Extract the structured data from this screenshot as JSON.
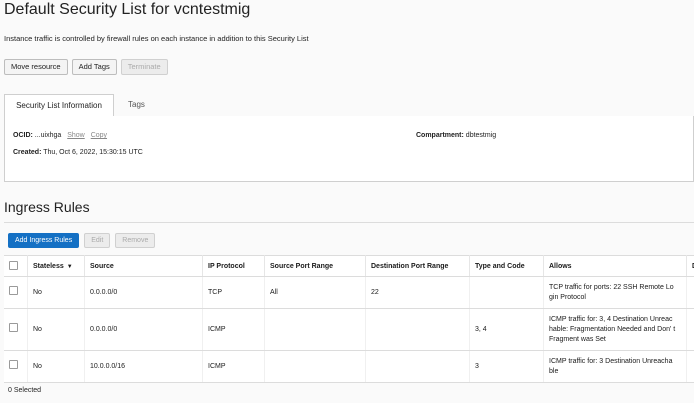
{
  "header": {
    "title": "Default Security List for vcntestmig",
    "description": "Instance traffic is controlled by firewall rules on each instance in addition to this Security List"
  },
  "actions": {
    "move": "Move resource",
    "tags": "Add Tags",
    "terminate": "Terminate"
  },
  "tabs": [
    {
      "label": "Security List Information"
    },
    {
      "label": "Tags"
    }
  ],
  "info": {
    "ocid_label": "OCID:",
    "ocid_value": "...uixhga",
    "show": "Show",
    "copy": "Copy",
    "created_label": "Created:",
    "created_value": "Thu, Oct 6, 2022, 15:30:15 UTC",
    "compartment_label": "Compartment:",
    "compartment_value": "dbtestmig"
  },
  "ingress": {
    "title": "Ingress Rules",
    "add": "Add Ingress Rules",
    "edit": "Edit",
    "remove": "Remove",
    "columns": [
      "Stateless",
      "Source",
      "IP Protocol",
      "Source Port Range",
      "Destination Port Range",
      "Type and Code",
      "Allows",
      "D"
    ],
    "rows": [
      {
        "stateless": "No",
        "source": "0.0.0.0/0",
        "protocol": "TCP",
        "src_port": "All",
        "dst_port": "22",
        "type_code": "",
        "allows": "TCP traffic for ports: 22 SSH Remote Lo gin Protocol"
      },
      {
        "stateless": "No",
        "source": "0.0.0.0/0",
        "protocol": "ICMP",
        "src_port": "",
        "dst_port": "",
        "type_code": "3, 4",
        "allows": "ICMP traffic for: 3, 4 Destination Unreac hable: Fragmentation Needed and Don' t Fragment was Set"
      },
      {
        "stateless": "No",
        "source": "10.0.0.0/16",
        "protocol": "ICMP",
        "src_port": "",
        "dst_port": "",
        "type_code": "3",
        "allows": "ICMP traffic for: 3 Destination Unreacha ble"
      }
    ],
    "footer": "0 Selected"
  }
}
